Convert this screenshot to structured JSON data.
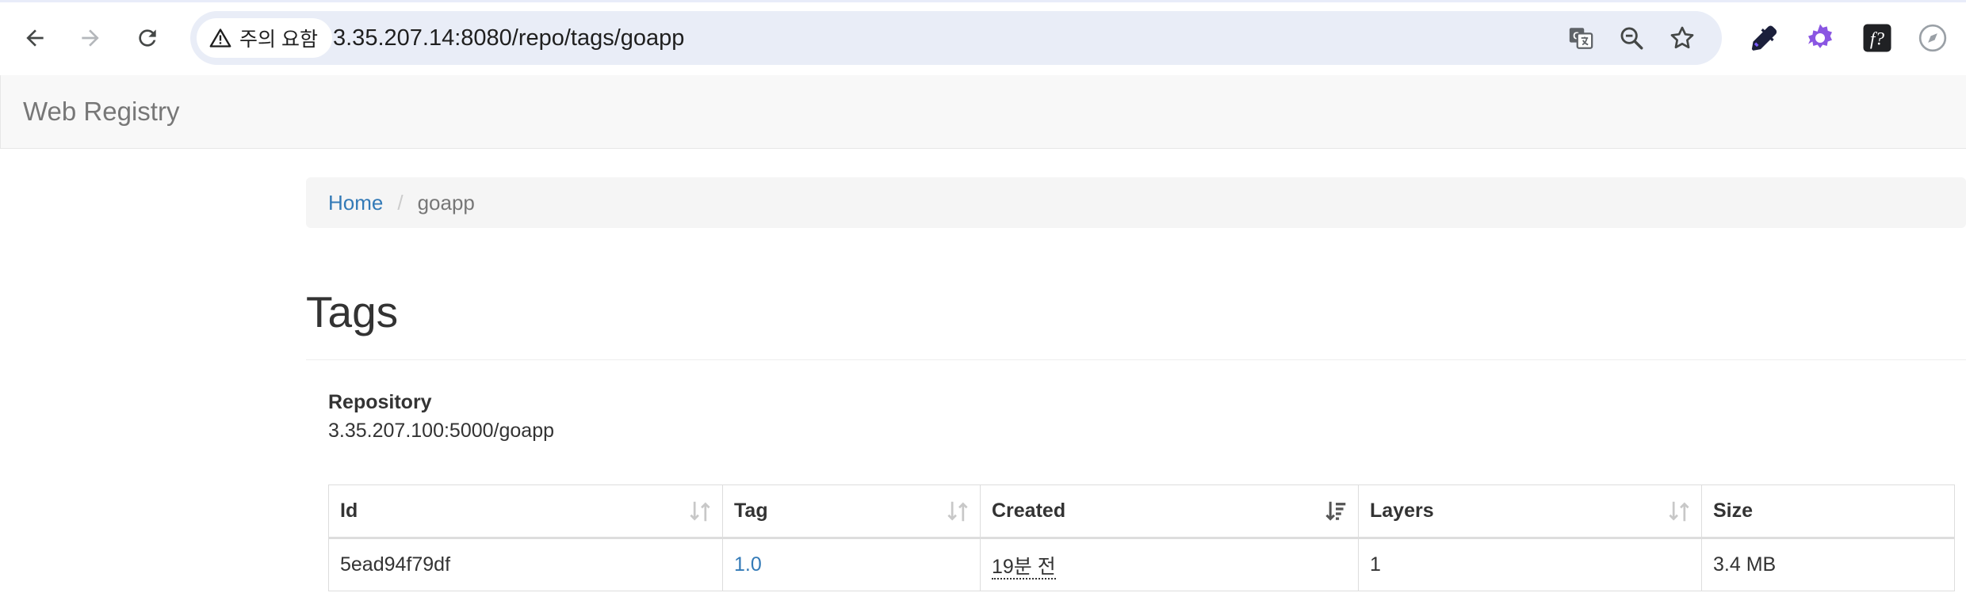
{
  "browser": {
    "security_label": "주의 요함",
    "url": "3.35.207.14:8080/repo/tags/goapp"
  },
  "navbar": {
    "brand": "Web Registry"
  },
  "breadcrumb": {
    "home": "Home",
    "separator": "/",
    "current": "goapp"
  },
  "page": {
    "title": "Tags"
  },
  "repository": {
    "label": "Repository",
    "value": "3.35.207.100:5000/goapp"
  },
  "table": {
    "headers": {
      "id": "Id",
      "tag": "Tag",
      "created": "Created",
      "layers": "Layers",
      "size": "Size"
    },
    "rows": [
      {
        "id": "5ead94f79df",
        "tag": "1.0",
        "created": "19분 전",
        "layers": "1",
        "size": "3.4 MB"
      }
    ]
  },
  "colors": {
    "link": "#337ab7",
    "navbar_bg": "#f8f8f8",
    "omnibox_bg": "#e9edf7"
  }
}
